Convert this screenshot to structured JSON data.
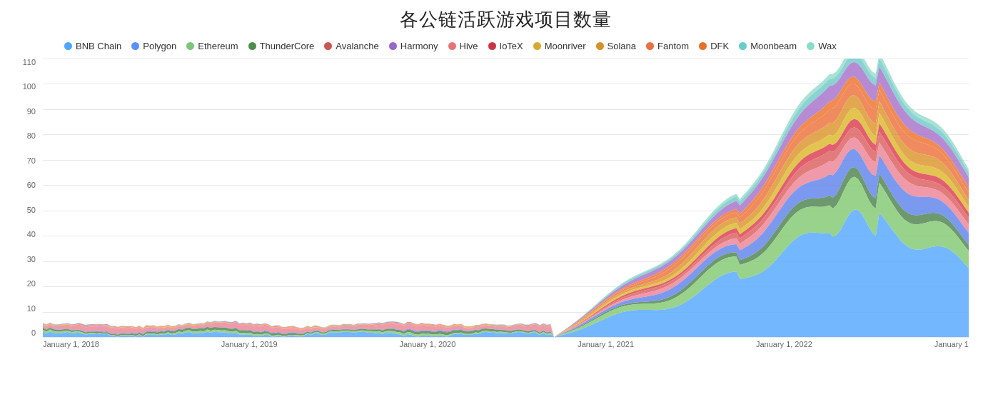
{
  "title": "各公链活跃游戏项目数量",
  "legend": [
    {
      "label": "BNB Chain",
      "color": "#4da6ff"
    },
    {
      "label": "Polygon",
      "color": "#5b8fff"
    },
    {
      "label": "Ethereum",
      "color": "#7bc67a"
    },
    {
      "label": "ThunderCore",
      "color": "#4d8c4d"
    },
    {
      "label": "Avalanche",
      "color": "#cc5555"
    },
    {
      "label": "Harmony",
      "color": "#9966cc"
    },
    {
      "label": "Hive",
      "color": "#e8727a"
    },
    {
      "label": "IoTeX",
      "color": "#cc3344"
    },
    {
      "label": "Moonriver",
      "color": "#d4aa30"
    },
    {
      "label": "Solana",
      "color": "#d4922a"
    },
    {
      "label": "Fantom",
      "color": "#e87040"
    },
    {
      "label": "DFK",
      "color": "#e8702a"
    },
    {
      "label": "Moonbeam",
      "color": "#66cccc"
    },
    {
      "label": "Wax",
      "color": "#88ddcc"
    }
  ],
  "yAxis": {
    "labels": [
      "0",
      "10",
      "20",
      "30",
      "40",
      "50",
      "60",
      "70",
      "80",
      "90",
      "100",
      "110"
    ]
  },
  "xAxis": {
    "labels": [
      "January 1, 2018",
      "January 1, 2019",
      "January 1, 2020",
      "January 1, 2021",
      "January 1, 2022",
      "January 1"
    ]
  },
  "colors": {
    "bnbChain": "#5aabff",
    "polygon": "#6688ee",
    "ethereum": "#88cc77",
    "thundercore": "#558855",
    "avalanche": "#dd6666",
    "harmony": "#aa77cc",
    "hive": "#ee8899",
    "iotex": "#dd4455",
    "moonriver": "#ddbb33",
    "solana": "#dd9933",
    "fantom": "#ee7744",
    "dfk": "#ee7733",
    "moonbeam": "#77cccc",
    "wax": "#99ddcc"
  }
}
